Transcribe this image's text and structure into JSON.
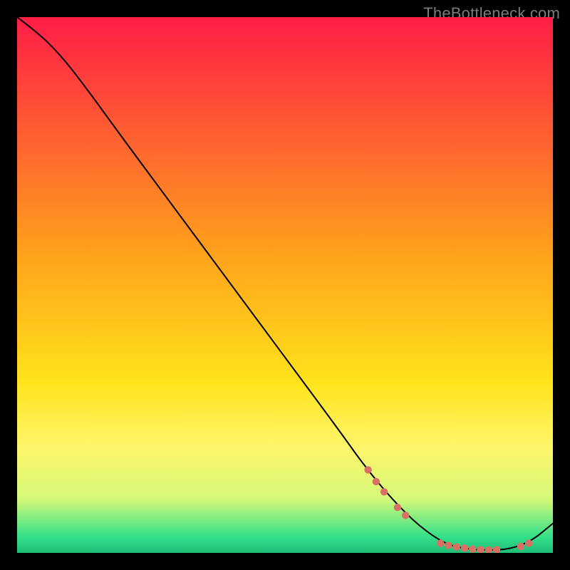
{
  "watermark": "TheBottleneck.com",
  "chart_data": {
    "type": "line",
    "title": "",
    "xlabel": "",
    "ylabel": "",
    "xlim": [
      0,
      100
    ],
    "ylim": [
      0,
      100
    ],
    "grid": false,
    "background_gradient": {
      "stops": [
        {
          "offset": 0,
          "color": "#ff1d46"
        },
        {
          "offset": 45,
          "color": "#ffa41b"
        },
        {
          "offset": 68,
          "color": "#ffe31b"
        },
        {
          "offset": 80,
          "color": "#fff56a"
        },
        {
          "offset": 90,
          "color": "#d4f97a"
        },
        {
          "offset": 97,
          "color": "#34e08a"
        },
        {
          "offset": 100,
          "color": "#1ebd77"
        }
      ]
    },
    "series": [
      {
        "name": "curve",
        "color": "#000000",
        "stroke_width": 2,
        "points": [
          {
            "x": 0,
            "y": 100
          },
          {
            "x": 4,
            "y": 97
          },
          {
            "x": 8,
            "y": 93
          },
          {
            "x": 12,
            "y": 88
          },
          {
            "x": 20,
            "y": 77
          },
          {
            "x": 30,
            "y": 63.5
          },
          {
            "x": 40,
            "y": 50
          },
          {
            "x": 50,
            "y": 36.5
          },
          {
            "x": 60,
            "y": 23
          },
          {
            "x": 65,
            "y": 16
          },
          {
            "x": 70,
            "y": 10
          },
          {
            "x": 75,
            "y": 5
          },
          {
            "x": 80,
            "y": 1.6
          },
          {
            "x": 84,
            "y": 0.7
          },
          {
            "x": 88,
            "y": 0.5
          },
          {
            "x": 92,
            "y": 0.7
          },
          {
            "x": 96,
            "y": 2.2
          },
          {
            "x": 100,
            "y": 5.5
          }
        ]
      }
    ],
    "markers": {
      "color": "#d87066",
      "radius": 5.2,
      "points": [
        {
          "x": 65.5,
          "y": 15.5
        },
        {
          "x": 67,
          "y": 13.3
        },
        {
          "x": 68.5,
          "y": 11.4
        },
        {
          "x": 71,
          "y": 8.5
        },
        {
          "x": 72.5,
          "y": 7
        },
        {
          "x": 79,
          "y": 1.8
        },
        {
          "x": 80.5,
          "y": 1.4
        },
        {
          "x": 82,
          "y": 1.1
        },
        {
          "x": 83.5,
          "y": 0.9
        },
        {
          "x": 85,
          "y": 0.7
        },
        {
          "x": 86.5,
          "y": 0.6
        },
        {
          "x": 88,
          "y": 0.55
        },
        {
          "x": 89.5,
          "y": 0.6
        },
        {
          "x": 94,
          "y": 1.2
        },
        {
          "x": 95.5,
          "y": 1.8
        }
      ]
    }
  }
}
